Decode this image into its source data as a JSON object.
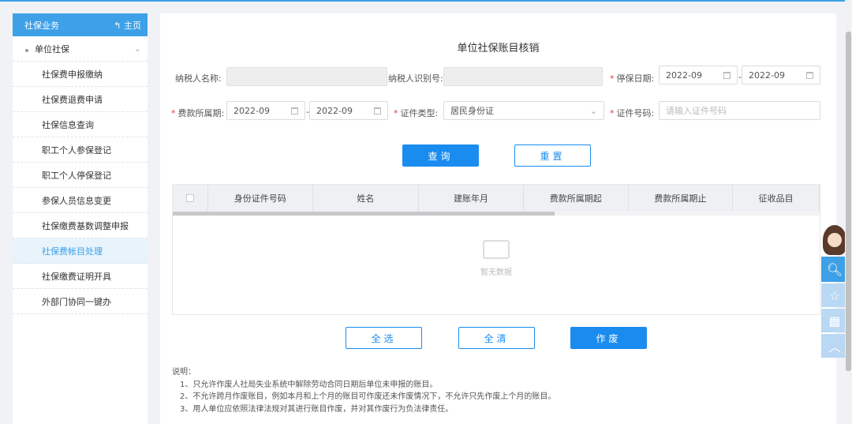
{
  "sidebar": {
    "title": "社保业务",
    "home": "主页",
    "group": "单位社保",
    "items": [
      "社保费申报缴纳",
      "社保费退费申请",
      "社保信息查询",
      "职工个人参保登记",
      "职工个人停保登记",
      "参保人员信息变更",
      "社保缴费基数调整申报",
      "社保费帐目处理",
      "社保缴费证明开具",
      "外部门协同一键办"
    ],
    "active_index": 7
  },
  "form": {
    "title": "单位社保账目核销",
    "taxpayer_name_label": "纳税人名称:",
    "taxpayer_id_label": "纳税人识别号:",
    "stop_date_label": "停保日期:",
    "stop_start": "2022-09",
    "stop_end": "2022-09",
    "period_label": "费款所属期:",
    "period_start": "2022-09",
    "period_end": "2022-09",
    "cert_type_label": "证件类型:",
    "cert_type": "居民身份证",
    "cert_no_label": "证件号码:",
    "cert_no_placeholder": "请输入证件号码",
    "dash": "-",
    "query": "查询",
    "reset": "重置"
  },
  "table": {
    "columns": [
      "身份证件号码",
      "姓名",
      "建账年月",
      "费款所属期起",
      "费款所属期止",
      "征收品目"
    ],
    "empty": "暂无数据"
  },
  "actions": {
    "select_all": "全选",
    "clear_all": "全清",
    "void": "作废"
  },
  "notes": {
    "title": "说明：",
    "lines": [
      "1、只允许作废人社局失业系统中解除劳动合同日期后单位未申报的账目。",
      "2、不允许跨月作废账目，例如本月和上个月的账目可作废还未作废情况下，不允许只先作废上个月的账目。",
      "3、用人单位应依照法律法规对其进行账目作废，并对其作废行为负法律责任。"
    ]
  },
  "colors": {
    "primary": "#1a8cef",
    "sidebar_header": "#3ea0e6"
  }
}
